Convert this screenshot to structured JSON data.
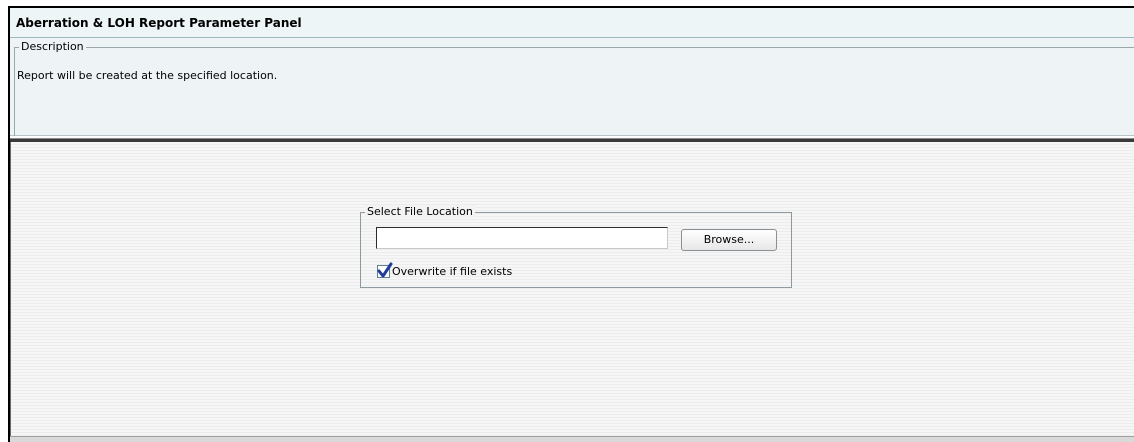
{
  "panel": {
    "title": "Aberration & LOH Report Parameter Panel"
  },
  "description": {
    "legend": "Description",
    "text": "Report will be created at the specified location."
  },
  "file_location": {
    "legend": "Select File Location",
    "input_value": "",
    "browse_label": "Browse...",
    "overwrite_label": "Overwrite if file exists",
    "overwrite_checked": true
  },
  "colors": {
    "title_bg": "#eef5f7",
    "desc_bg": "#eef3f6",
    "check_mark": "#1f3d9a"
  },
  "icons": {
    "checkbox_mark": "check-icon"
  }
}
